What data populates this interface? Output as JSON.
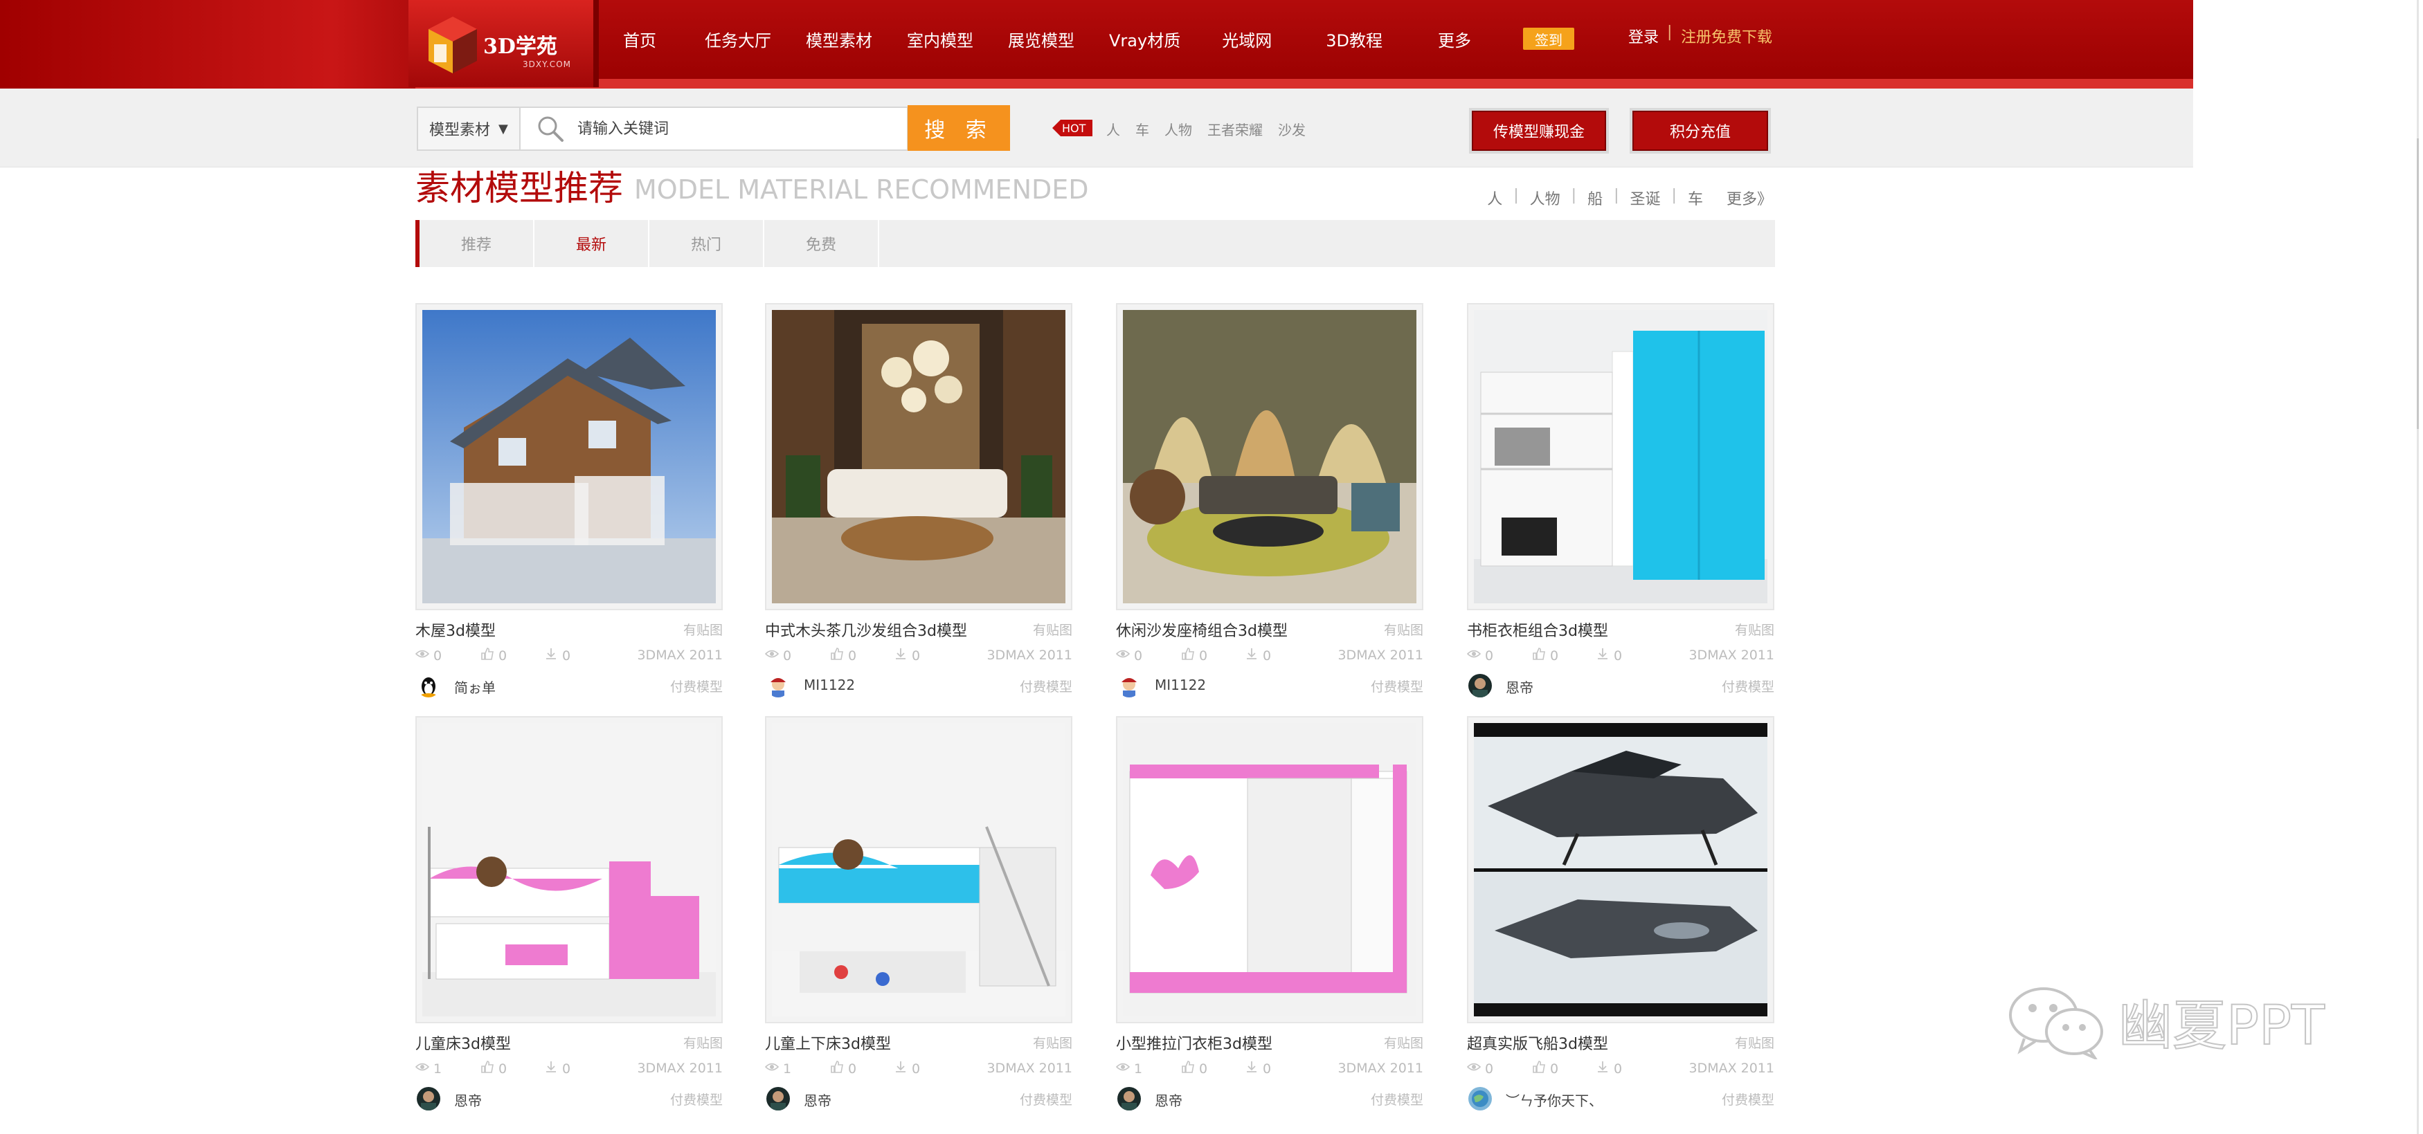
{
  "logo": {
    "title": "3D学苑",
    "subtitle": "3DXY.COM"
  },
  "nav": {
    "items": [
      "首页",
      "任务大厅",
      "模型素材",
      "室内模型",
      "展览模型",
      "Vray材质",
      "光域网",
      "3D教程",
      "更多"
    ],
    "signin": "签到",
    "login": "登录",
    "separator": "|",
    "register": "注册免费下载"
  },
  "search": {
    "category": "模型素材",
    "placeholder": "请输入关键词",
    "button": "搜 索",
    "hot_label": "HOT",
    "hot_tags": [
      "人",
      "车",
      "人物",
      "王者荣耀",
      "沙发"
    ]
  },
  "actions": {
    "upload": "传模型赚现金",
    "topup": "积分充值"
  },
  "section": {
    "title": "素材模型推荐",
    "title_en": "MODEL MATERIAL RECOMMENDED",
    "tags": [
      "人",
      "人物",
      "船",
      "圣诞",
      "车"
    ],
    "more": "更多》",
    "tabs": [
      "推荐",
      "最新",
      "热门",
      "免费"
    ],
    "active_tab": 1
  },
  "cards": [
    {
      "title": "木屋3d模型",
      "tex": "有贴图",
      "views": "0",
      "likes": "0",
      "downloads": "0",
      "version": "3DMAX 2011",
      "user": "简ぉ单",
      "paid": "付费模型",
      "thumb": "house-icon",
      "avatar": "penguin-icon"
    },
    {
      "title": "中式木头茶几沙发组合3d模型",
      "tex": "有贴图",
      "views": "0",
      "likes": "0",
      "downloads": "0",
      "version": "3DMAX 2011",
      "user": "MI1122",
      "paid": "付费模型",
      "thumb": "living-room-icon",
      "avatar": "cartoon-icon"
    },
    {
      "title": "休闲沙发座椅组合3d模型",
      "tex": "有贴图",
      "views": "0",
      "likes": "0",
      "downloads": "0",
      "version": "3DMAX 2011",
      "user": "MI1122",
      "paid": "付费模型",
      "thumb": "lounge-icon",
      "avatar": "cartoon-icon"
    },
    {
      "title": "书柜衣柜组合3d模型",
      "tex": "有贴图",
      "views": "0",
      "likes": "0",
      "downloads": "0",
      "version": "3DMAX 2011",
      "user": "恩帝",
      "paid": "付费模型",
      "thumb": "wardrobe-icon",
      "avatar": "portrait-icon"
    },
    {
      "title": "儿童床3d模型",
      "tex": "有贴图",
      "views": "1",
      "likes": "0",
      "downloads": "0",
      "version": "3DMAX 2011",
      "user": "恩帝",
      "paid": "付费模型",
      "thumb": "bunk-pink-icon",
      "avatar": "portrait-icon"
    },
    {
      "title": "儿童上下床3d模型",
      "tex": "有贴图",
      "views": "1",
      "likes": "0",
      "downloads": "0",
      "version": "3DMAX 2011",
      "user": "恩帝",
      "paid": "付费模型",
      "thumb": "bunk-blue-icon",
      "avatar": "portrait-icon"
    },
    {
      "title": "小型推拉门衣柜3d模型",
      "tex": "有贴图",
      "views": "1",
      "likes": "0",
      "downloads": "0",
      "version": "3DMAX 2011",
      "user": "恩帝",
      "paid": "付费模型",
      "thumb": "sliding-wardrobe-icon",
      "avatar": "portrait-icon"
    },
    {
      "title": "超真实版飞船3d模型",
      "tex": "有贴图",
      "views": "0",
      "likes": "0",
      "downloads": "0",
      "version": "3DMAX 2011",
      "user": "︶ㄣ予你天下、",
      "paid": "付费模型",
      "thumb": "spaceship-icon",
      "avatar": "globe-icon"
    }
  ],
  "watermark": "幽夏PPT",
  "colors": {
    "brand_red": "#b30b0b",
    "accent_orange": "#f5921e",
    "hot_red": "#c40d0d"
  }
}
